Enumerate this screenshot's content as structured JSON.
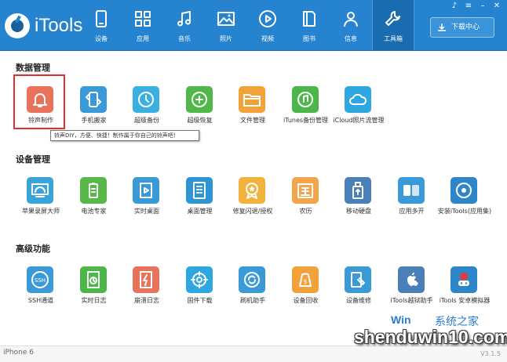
{
  "app": {
    "name": "iTools"
  },
  "nav": [
    {
      "label": "设备",
      "icon": "device-icon"
    },
    {
      "label": "应用",
      "icon": "apps-grid-icon"
    },
    {
      "label": "音乐",
      "icon": "music-note-icon"
    },
    {
      "label": "照片",
      "icon": "photo-icon"
    },
    {
      "label": "视频",
      "icon": "video-play-icon"
    },
    {
      "label": "图书",
      "icon": "book-icon"
    },
    {
      "label": "信息",
      "icon": "user-info-icon"
    },
    {
      "label": "工具箱",
      "icon": "toolbox-icon",
      "active": true
    }
  ],
  "toolbar": {
    "download_label": "下载中心"
  },
  "sections": [
    {
      "title": "数据管理",
      "items": [
        {
          "label": "铃声制作",
          "color": "#e9725b",
          "icon": "bell-icon"
        },
        {
          "label": "手机搬家",
          "color": "#3a9ad8",
          "icon": "phone-transfer-icon"
        },
        {
          "label": "超级备份",
          "color": "#39b0e0",
          "icon": "backup-clock-icon"
        },
        {
          "label": "超级恢复",
          "color": "#50b848",
          "icon": "restore-plus-icon"
        },
        {
          "label": "文件管理",
          "color": "#f2a23b",
          "icon": "folder-icon"
        },
        {
          "label": "iTunes备份管理",
          "color": "#4cb64a",
          "icon": "itunes-backup-icon"
        },
        {
          "label": "iCloud照片流管理",
          "color": "#2ea7e0",
          "icon": "cloud-icon"
        }
      ]
    },
    {
      "title": "设备管理",
      "items": [
        {
          "label": "苹果录屏大师",
          "color": "#3aa4d9",
          "icon": "screen-cast-icon"
        },
        {
          "label": "电池专家",
          "color": "#57b848",
          "icon": "battery-icon"
        },
        {
          "label": "实时桌面",
          "color": "#3a9ad8",
          "icon": "live-desktop-icon"
        },
        {
          "label": "桌面管理",
          "color": "#2e95d4",
          "icon": "desktop-grid-icon"
        },
        {
          "label": "修复闪退/授权",
          "color": "#f2b33d",
          "icon": "repair-badge-icon"
        },
        {
          "label": "农历",
          "color": "#f2a54a",
          "icon": "lunar-calendar-icon"
        },
        {
          "label": "移动硬盘",
          "color": "#4a7fb8",
          "icon": "usb-drive-icon"
        },
        {
          "label": "应用多开",
          "color": "#3a9ad8",
          "icon": "multi-app-icon"
        },
        {
          "label": "安装iTools(应用集)",
          "color": "#2e86c9",
          "icon": "install-itools-icon"
        }
      ]
    },
    {
      "title": "高级功能",
      "items": [
        {
          "label": "SSH通道",
          "color": "#3a9ad8",
          "icon": "ssh-icon"
        },
        {
          "label": "实时日志",
          "color": "#4cb64a",
          "icon": "realtime-log-icon"
        },
        {
          "label": "崩溃日志",
          "color": "#e9725b",
          "icon": "crash-log-icon"
        },
        {
          "label": "固件下载",
          "color": "#2ea7e0",
          "icon": "firmware-gear-icon"
        },
        {
          "label": "刷机助手",
          "color": "#3a9ad8",
          "icon": "flash-assistant-icon"
        },
        {
          "label": "设备回收",
          "color": "#f2a23b",
          "icon": "device-recycle-icon"
        },
        {
          "label": "设备维修",
          "color": "#3a9ad8",
          "icon": "repair-wrench-icon"
        },
        {
          "label": "iTools越狱助手",
          "color": "#4a7fb8",
          "icon": "apple-icon"
        },
        {
          "label": "iTools 安卓模拟器",
          "color": "#2e86c9",
          "icon": "android-emulator-icon"
        }
      ]
    }
  ],
  "tooltip": "铃声DIY，方便、快捷！制作属于你自己的铃声吧！",
  "status": {
    "device": "iPhone 6",
    "version": "V3.1.5"
  },
  "watermark": {
    "line1": "Win",
    "line2": "系统之家",
    "line3": "shenduwin10.com"
  }
}
